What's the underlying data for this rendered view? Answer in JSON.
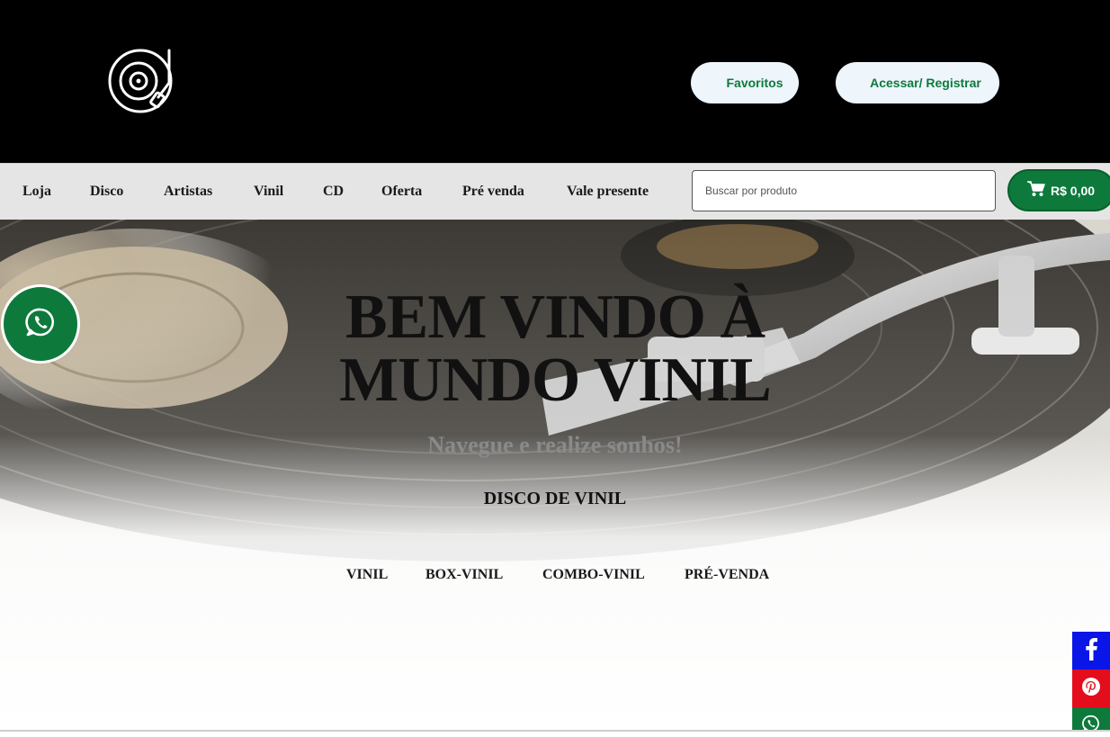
{
  "header": {
    "logo_icon": "turntable-icon",
    "favorites_label": "Favoritos",
    "account_label": "Acessar/ Registrar"
  },
  "nav": {
    "items": [
      "Loja",
      "Disco",
      "Artistas",
      "Vinil",
      "CD",
      "Oferta",
      "Pré venda",
      "Vale presente"
    ],
    "search_placeholder": "Buscar por produto",
    "cart_total": "R$ 0,00",
    "cart_icon": "cart-icon"
  },
  "hero": {
    "title_line1": "BEM VINDO À",
    "title_line2": "MUNDO VINIL",
    "subtitle": "Navegue e realize sonhos!",
    "section_title": "DISCO DE VINIL",
    "categories": [
      "VINIL",
      "BOX-VINIL",
      "COMBO-VINIL",
      "PRÉ-VENDA"
    ]
  },
  "floating": {
    "whatsapp_icon": "whatsapp-icon"
  },
  "social": {
    "icons": [
      "facebook-icon",
      "pinterest-icon",
      "whatsapp-icon"
    ]
  },
  "colors": {
    "brand_green": "#0d7a3c",
    "header_bg": "#000000",
    "nav_bg": "#e5e5e5",
    "facebook": "#0a15e8",
    "pinterest": "#e30d1b"
  }
}
